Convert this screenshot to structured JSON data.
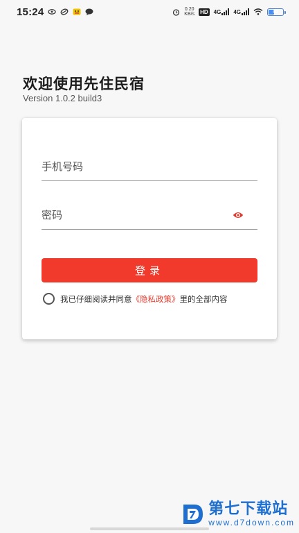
{
  "status_bar": {
    "time": "15:24",
    "net_speed_value": "0.20",
    "net_speed_unit": "KB/s",
    "hd_label": "HD",
    "sim1_label": "4G",
    "sim2_label": "4G",
    "battery_level": "40",
    "battery_fraction": 0.4,
    "battery_color": "#4a8df0"
  },
  "header": {
    "title": "欢迎使用先住民宿",
    "version": "Version 1.0.2 build3"
  },
  "login_form": {
    "phone_placeholder": "手机号码",
    "password_placeholder": "密码",
    "password_toggle_icon": "eye-icon",
    "login_label": "登录",
    "login_button_color": "#f13a2b",
    "agreement_prefix": "我已仔细阅读并同意",
    "policy_link": "《隐私政策》",
    "agreement_suffix": "里的全部内容"
  },
  "watermark": {
    "name": "第七下载站",
    "url": "www.d7down.com",
    "color": "#1e6fd0"
  }
}
